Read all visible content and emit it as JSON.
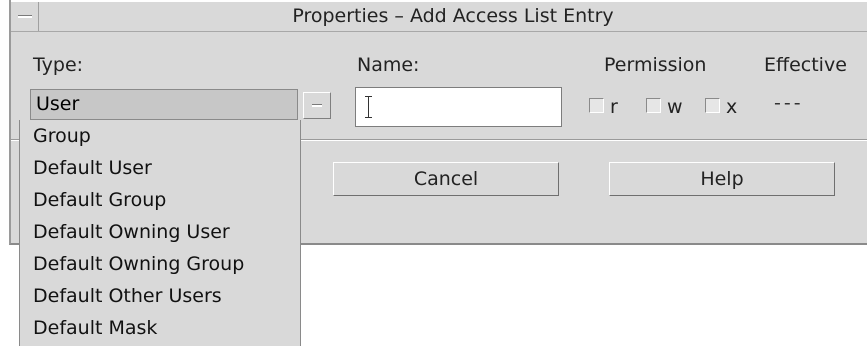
{
  "window": {
    "title": "Properties – Add Access List Entry"
  },
  "labels": {
    "type": "Type:",
    "name": "Name:",
    "permission": "Permission",
    "effective": "Effective"
  },
  "type_select": {
    "selected": "User",
    "options": [
      "Group",
      "Default User",
      "Default Group",
      "Default Owning User",
      "Default Owning Group",
      "Default Other Users",
      "Default Mask"
    ]
  },
  "name_field": {
    "value": ""
  },
  "permissions": [
    {
      "label": "r",
      "checked": false
    },
    {
      "label": "w",
      "checked": false
    },
    {
      "label": "x",
      "checked": false
    }
  ],
  "effective_value": "---",
  "buttons": {
    "cancel": "Cancel",
    "help": "Help"
  }
}
